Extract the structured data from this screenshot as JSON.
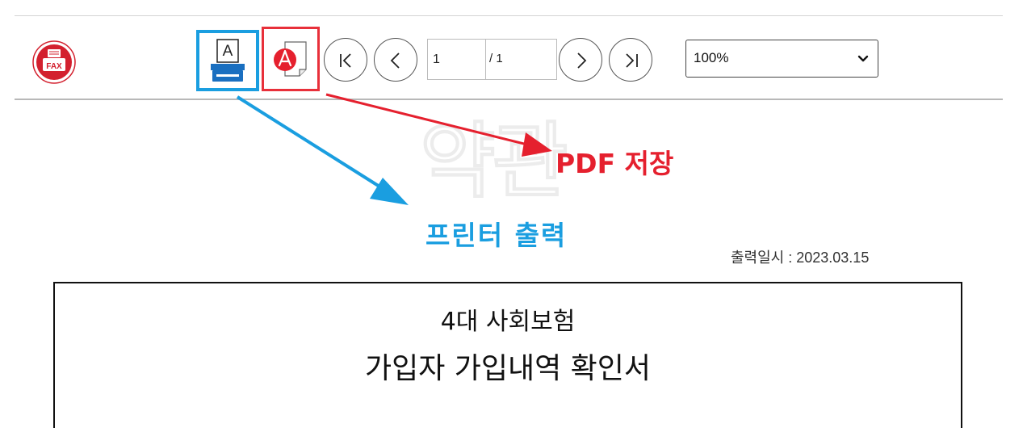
{
  "toolbar": {
    "fax_label": "FAX",
    "print_label": "A",
    "page_current": "1",
    "page_total": "/ 1",
    "zoom": "100%"
  },
  "annotations": {
    "pdf_save": "PDF 저장",
    "print_output": "프린터 출력"
  },
  "watermark": "약관",
  "document": {
    "output_date": "출력일시 : 2023.03.15",
    "title_line1": "4대 사회보험",
    "title_line2": "가입자 가입내역 확인서"
  },
  "colors": {
    "print_highlight": "#1a9ee0",
    "pdf_highlight": "#e8303a",
    "fax_red": "#d3202e"
  }
}
